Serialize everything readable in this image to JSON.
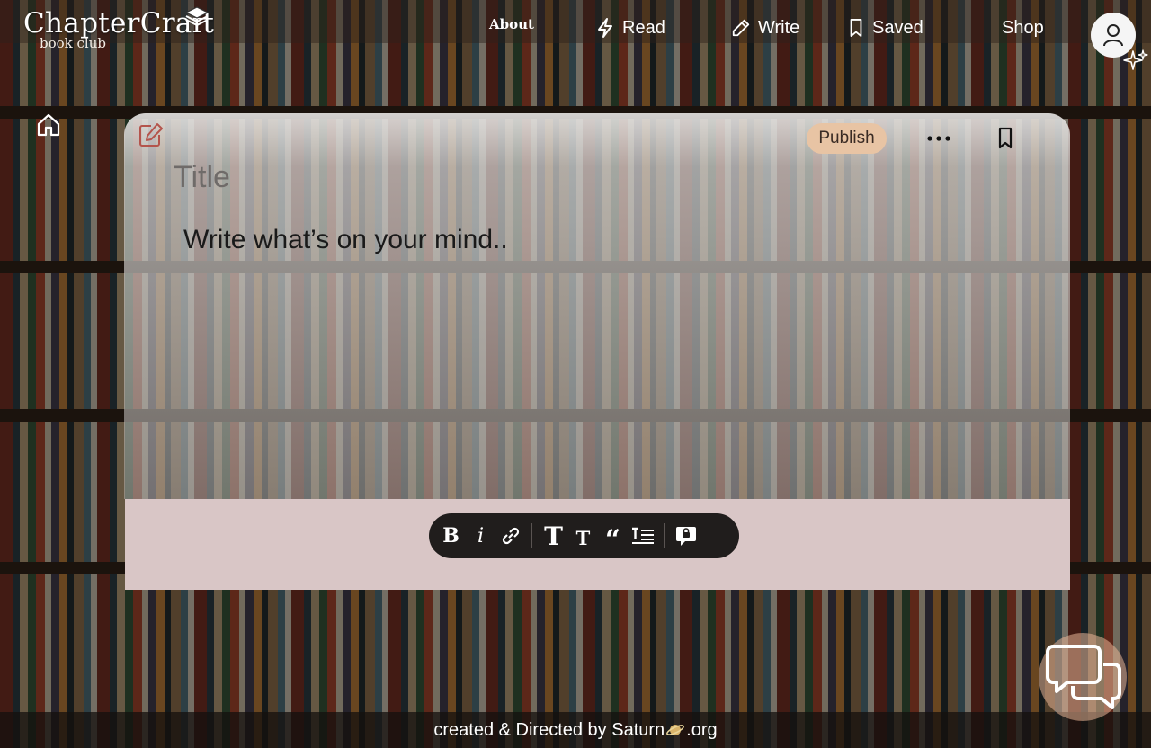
{
  "brand": {
    "title": "ChapterCraft",
    "subtitle": "book club",
    "icon": "stacked-layers-icon"
  },
  "nav": {
    "about": "About",
    "items": [
      {
        "label": "Read",
        "icon": "lightning-icon"
      },
      {
        "label": "Write",
        "icon": "pencil-icon"
      },
      {
        "label": "Saved",
        "icon": "bookmark-icon"
      },
      {
        "label": "Shop",
        "icon": ""
      }
    ]
  },
  "editor": {
    "publish_label": "Publish",
    "title_placeholder": "Title",
    "body_placeholder": "Write what’s on your mind..",
    "toolbar": [
      "bold",
      "italic",
      "link",
      "large-heading",
      "small-heading",
      "quote",
      "text-align",
      "comment"
    ]
  },
  "footer": {
    "text_before": "created & Directed by Saturn",
    "text_after": ".org"
  },
  "colors": {
    "publish_bg": "#e8c4a4",
    "editor_bottom": "#d9c6c6",
    "toolbar_bg": "#201d1c",
    "accent_edit": "#b4544c"
  }
}
